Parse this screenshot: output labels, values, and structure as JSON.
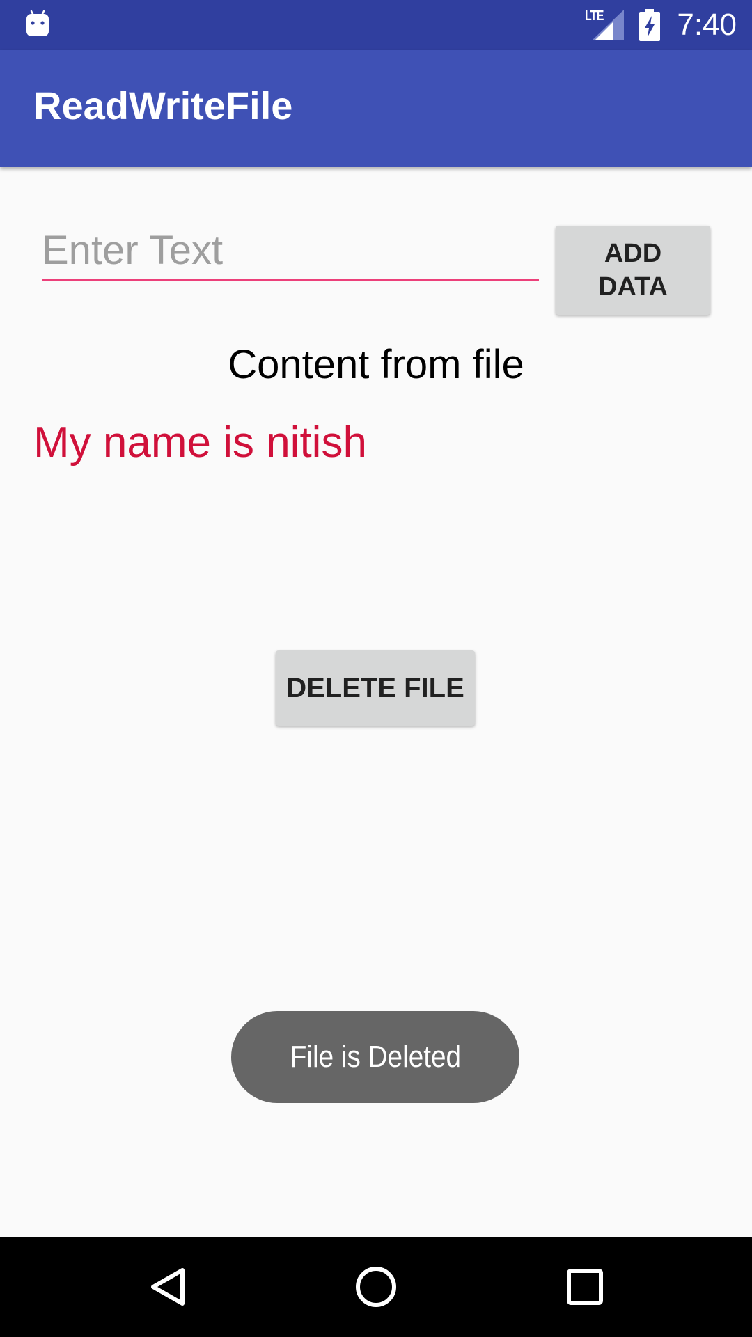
{
  "status_bar": {
    "network_type": "LTE",
    "time": "7:40",
    "icons": [
      "android-icon",
      "lte-signal-icon",
      "battery-charging-icon"
    ]
  },
  "app_bar": {
    "title": "ReadWriteFile"
  },
  "input": {
    "placeholder": "Enter Text",
    "value": ""
  },
  "buttons": {
    "add_data_line1": "ADD",
    "add_data_line2": "DATA",
    "delete_file": "DELETE FILE"
  },
  "content": {
    "heading": "Content from file",
    "file_text": "My name is nitish"
  },
  "toast": {
    "message": "File is Deleted"
  },
  "nav_bar": {
    "icons": [
      "back-icon",
      "home-icon",
      "recents-icon"
    ]
  },
  "colors": {
    "status_bar": "#303f9f",
    "app_bar": "#3f51b5",
    "accent": "#ec407a",
    "file_text": "#d0103a",
    "toast": "#666666"
  }
}
